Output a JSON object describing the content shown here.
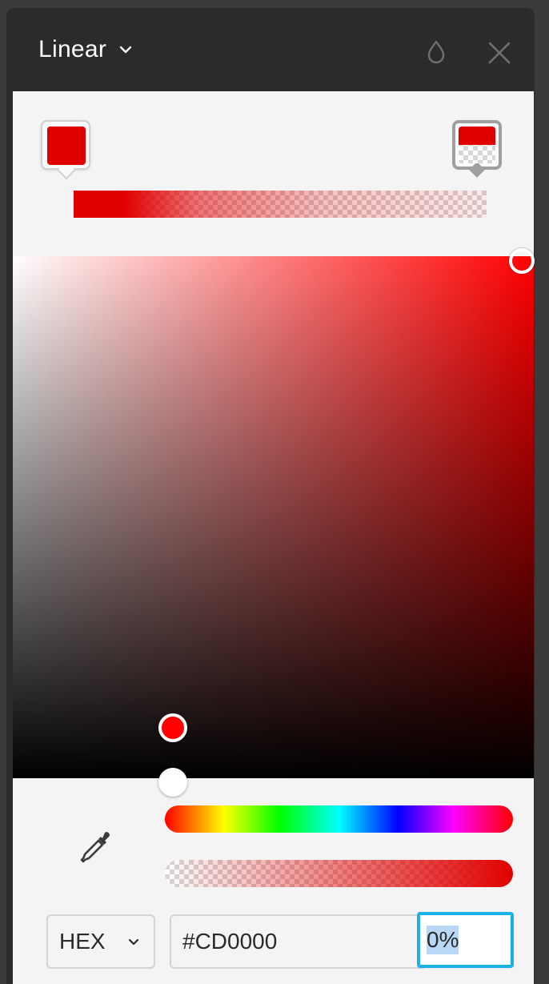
{
  "header": {
    "gradient_type": "Linear",
    "icons": {
      "dropdown": "chevron-down-icon",
      "opacity": "drop-icon",
      "close": "close-icon"
    }
  },
  "gradient": {
    "stop_left_color": "#e10000",
    "stop_right_color": "#e10000",
    "stop_right_alpha": 0
  },
  "picker": {
    "hue_color": "#ff0000",
    "hue_position_percent": 0,
    "alpha_position_percent": 0
  },
  "inputs": {
    "format": "HEX",
    "hex_value": "#CD0000",
    "alpha_value": "0%"
  },
  "colors": {
    "header_bg": "#2b2b2b",
    "panel_bg": "#f4f4f4",
    "focus_border": "#1ab0e8",
    "selection": "#b9d7f7"
  }
}
